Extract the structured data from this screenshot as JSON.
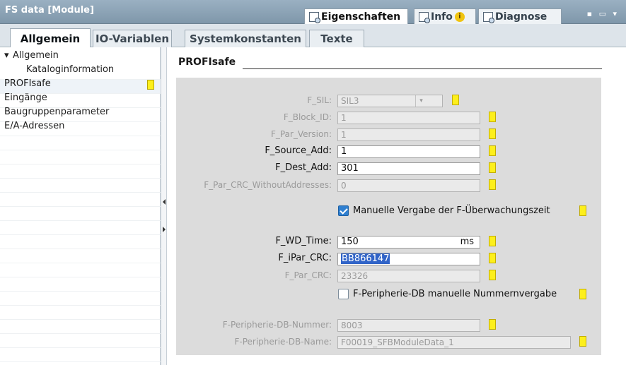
{
  "window": {
    "title": "FS data [Module]",
    "right_tabs": [
      {
        "label": "Eigenschaften",
        "icon": "properties-icon"
      },
      {
        "label": "Info",
        "icon": "info-icon"
      },
      {
        "label": "Diagnose",
        "icon": "diagnostics-icon"
      }
    ]
  },
  "tabs": [
    "Allgemein",
    "IO-Variablen",
    "Systemkonstanten",
    "Texte"
  ],
  "nav": {
    "items": [
      {
        "label": "Allgemein",
        "expanded": true
      },
      {
        "label": "Kataloginformation"
      },
      {
        "label": "PROFIsafe",
        "selected": true
      },
      {
        "label": "Eingänge"
      },
      {
        "label": "Baugruppenparameter"
      },
      {
        "label": "E/A-Adressen"
      }
    ]
  },
  "section": {
    "title": "PROFIsafe",
    "fields": {
      "f_sil": {
        "label": "F_SIL:",
        "value": "SIL3"
      },
      "f_block_id": {
        "label": "F_Block_ID:",
        "value": "1"
      },
      "f_par_version": {
        "label": "F_Par_Version:",
        "value": "1"
      },
      "f_source_add": {
        "label": "F_Source_Add:",
        "value": "1"
      },
      "f_dest_add": {
        "label": "F_Dest_Add:",
        "value": "301"
      },
      "f_par_crc_wo": {
        "label": "F_Par_CRC_WithoutAddresses:",
        "value": "0"
      },
      "manual_wd": {
        "label": "Manuelle Vergabe der F-Überwachungszeit",
        "checked": true
      },
      "f_wd_time": {
        "label": "F_WD_Time:",
        "value": "150",
        "unit": "ms"
      },
      "f_ipar_crc": {
        "label": "F_iPar_CRC:",
        "value": "BB866147"
      },
      "f_par_crc": {
        "label": "F_Par_CRC:",
        "value": "23326"
      },
      "manual_db": {
        "label": "F-Peripherie-DB manuelle Nummernvergabe",
        "checked": false
      },
      "db_number": {
        "label": "F-Peripherie-DB-Nummer:",
        "value": "8003"
      },
      "db_name": {
        "label": "F-Peripherie-DB-Name:",
        "value": "F00019_SFBModuleData_1"
      }
    }
  }
}
